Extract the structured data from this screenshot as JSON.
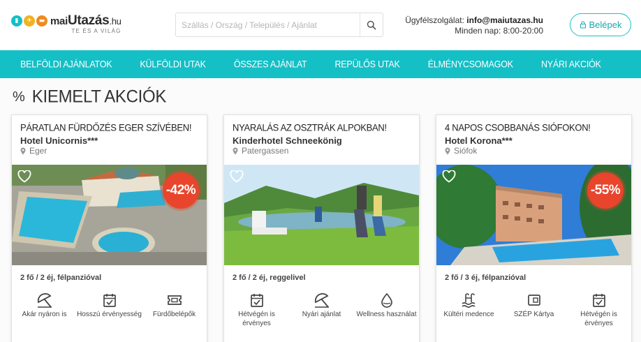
{
  "header": {
    "logo_prefix": "mai",
    "logo_main": "Utazás",
    "logo_tld": ".hu",
    "tagline": "TE ÉS A VILÁG",
    "search_placeholder": "Szállás / Ország / Település / Ajánlat",
    "contact_label": "Ügyfélszolgálat:",
    "contact_email": "info@maiutazas.hu",
    "contact_hours": "Minden nap: 8:00-20:00",
    "login_label": "Belépek"
  },
  "nav": [
    "BELFÖLDI AJÁNLATOK",
    "KÜLFÖLDI UTAK",
    "ÖSSZES AJÁNLAT",
    "REPÜLŐS UTAK",
    "ÉLMÉNYCSOMAGOK",
    "NYÁRI AKCIÓK"
  ],
  "section": {
    "icon": "%",
    "title": "KIEMELT AKCIÓK"
  },
  "cards": [
    {
      "title": "PÁRATLAN FÜRDŐZÉS EGER SZÍVÉBEN!",
      "hotel": "Hotel Unicornis***",
      "location": "Eger",
      "discount": "-42%",
      "offer": "2 fő / 2 éj, félpanzióval",
      "features": [
        {
          "icon": "umbrella-icon",
          "label": "Akár nyáron is"
        },
        {
          "icon": "calendar-check-icon",
          "label": "Hosszú érvényesség"
        },
        {
          "icon": "ticket-icon",
          "label": "Fürdőbelépők"
        }
      ]
    },
    {
      "title": "NYARALÁS AZ OSZTRÁK ALPOKBAN!",
      "hotel": "Kinderhotel Schneekönig",
      "location": "Patergassen",
      "discount": "",
      "offer": "2 fő / 2 éj, reggelivel",
      "features": [
        {
          "icon": "calendar-check-icon",
          "label": "Hétvégén is érvényes"
        },
        {
          "icon": "umbrella-icon",
          "label": "Nyári ajánlat"
        },
        {
          "icon": "drop-icon",
          "label": "Wellness használat"
        }
      ]
    },
    {
      "title": "4 NAPOS CSOBBANÁS SIÓFOKON!",
      "hotel": "Hotel Korona***",
      "location": "Siófok",
      "discount": "-55%",
      "offer": "2 fő / 3 éj, félpanzióval",
      "features": [
        {
          "icon": "pool-icon",
          "label": "Kültéri medence"
        },
        {
          "icon": "card-icon",
          "label": "SZÉP Kártya"
        },
        {
          "icon": "calendar-check-icon",
          "label": "Hétvégén is érvényes"
        }
      ]
    }
  ],
  "colors": {
    "accent": "#14bfc6",
    "discount": "#e8452c"
  }
}
